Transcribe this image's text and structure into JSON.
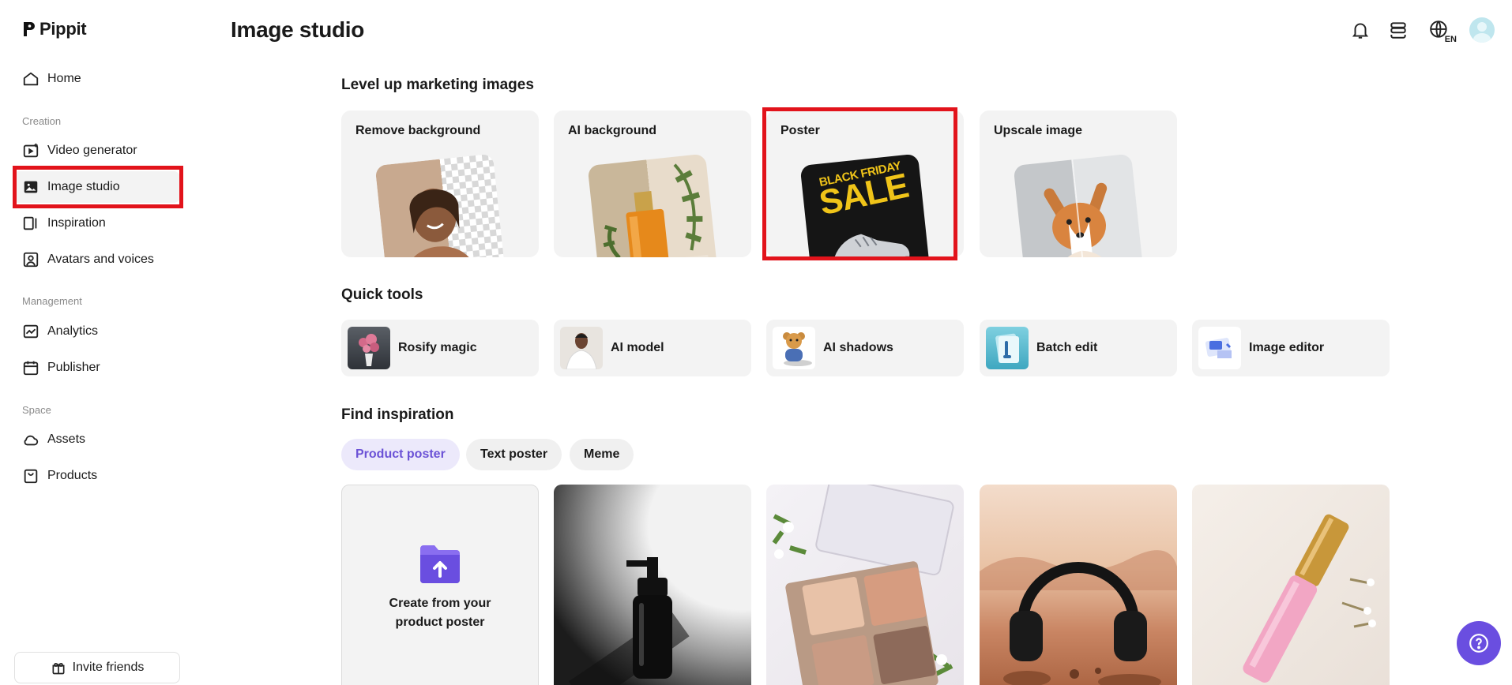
{
  "app": {
    "name": "Pippit"
  },
  "header": {
    "title": "Image studio",
    "language": "EN"
  },
  "sidebar": {
    "home": "Home",
    "sections": [
      "Creation",
      "Management",
      "Space"
    ],
    "creation_items": [
      "Video generator",
      "Image studio",
      "Inspiration",
      "Avatars and voices"
    ],
    "management_items": [
      "Analytics",
      "Publisher"
    ],
    "space_items": [
      "Assets",
      "Products"
    ],
    "invite_label": "Invite friends"
  },
  "main": {
    "level_up_title": "Level up marketing images",
    "feature_cards": [
      {
        "label": "Remove background"
      },
      {
        "label": "AI background"
      },
      {
        "label": "Poster",
        "image_text_top": "BLACK FRIDAY",
        "image_text_main": "SALE"
      },
      {
        "label": "Upscale image"
      }
    ],
    "quick_tools_title": "Quick tools",
    "quick_tools": [
      {
        "label": "Rosify magic"
      },
      {
        "label": "AI model"
      },
      {
        "label": "AI shadows"
      },
      {
        "label": "Batch edit"
      },
      {
        "label": "Image editor"
      }
    ],
    "find_inspiration_title": "Find inspiration",
    "tabs": [
      {
        "label": "Product poster",
        "active": true
      },
      {
        "label": "Text poster",
        "active": false
      },
      {
        "label": "Meme",
        "active": false
      }
    ],
    "create_card_text": "Create from your product poster"
  },
  "colors": {
    "accent": "#6a4ee0",
    "highlight_red": "#e2131b",
    "active_tab_bg": "#ece9fb",
    "active_tab_text": "#6b52d6"
  }
}
